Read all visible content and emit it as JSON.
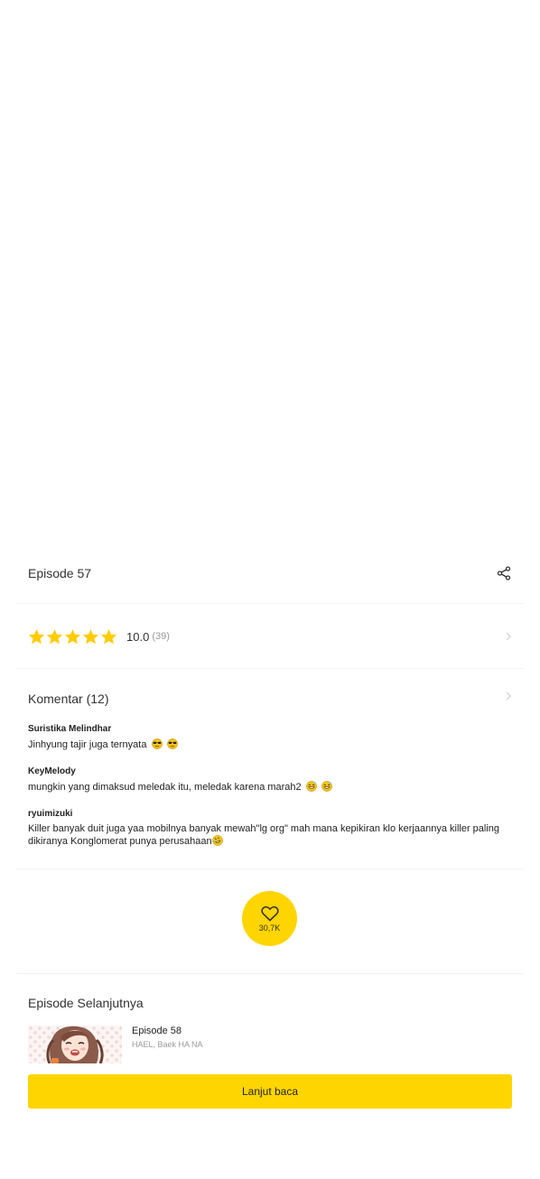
{
  "episode": {
    "title": "Episode 57"
  },
  "rating": {
    "stars_filled": 5,
    "stars_total": 5,
    "value": "10.0",
    "count": "(39)",
    "star_color": "#ffcc00"
  },
  "comments": {
    "title": "Komentar (12)",
    "items": [
      {
        "author": "Suristika Melindhar",
        "text": "Jinhyung tajir juga ternyata",
        "emojis": [
          "sunglasses-emoji",
          "sunglasses-emoji"
        ]
      },
      {
        "author": "KeyMelody",
        "text": "mungkin yang dimaksud meledak itu, meledak karena marah2",
        "emojis": [
          "grinning-sweat-emoji",
          "grinning-sweat-emoji"
        ]
      },
      {
        "author": "ryuimizuki",
        "text": "Killer banyak duit juga yaa mobilnya banyak mewah\"lg org\" mah mana kepikiran klo kerjaannya killer paling dikiranya Konglomerat punya perusahaan",
        "emojis": [
          "rolling-laughing-emoji"
        ]
      }
    ]
  },
  "like": {
    "count": "30,7K",
    "color": "#ffd500"
  },
  "next": {
    "section_title": "Episode Selanjutnya",
    "episode": "Episode 58",
    "authors": "HAEL, Baek HA NA"
  },
  "cta": {
    "label": "Lanjut baca",
    "color": "#ffd500"
  }
}
